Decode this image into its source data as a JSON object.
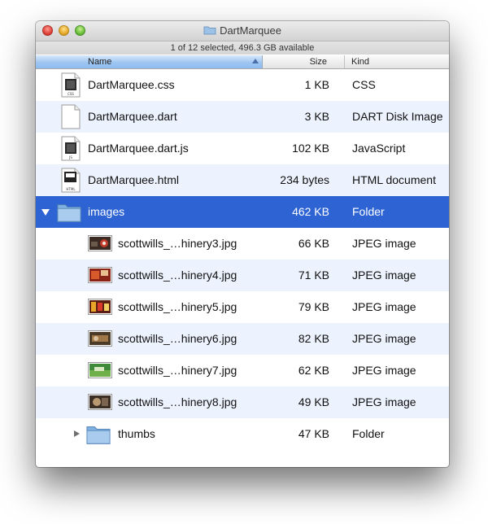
{
  "window": {
    "title": "DartMarquee",
    "status": "1 of 12 selected, 496.3 GB available"
  },
  "columns": {
    "name": "Name",
    "size": "Size",
    "kind": "Kind"
  },
  "rows": [
    {
      "name": "DartMarquee.css",
      "size": "1 KB",
      "kind": "CSS",
      "icon": "css-file-icon",
      "badge": "CSS"
    },
    {
      "name": "DartMarquee.dart",
      "size": "3 KB",
      "kind": "DART Disk Image",
      "icon": "blank-file-icon",
      "badge": ""
    },
    {
      "name": "DartMarquee.dart.js",
      "size": "102 KB",
      "kind": "JavaScript",
      "icon": "js-file-icon",
      "badge": "JS"
    },
    {
      "name": "DartMarquee.html",
      "size": "234 bytes",
      "kind": "HTML document",
      "icon": "html-file-icon",
      "badge": "HTML"
    },
    {
      "name": "images",
      "size": "462 KB",
      "kind": "Folder",
      "icon": "folder-icon"
    },
    {
      "name": "scottwills_…hinery3.jpg",
      "size": "66 KB",
      "kind": "JPEG image",
      "icon": "jpeg-thumbnail-icon"
    },
    {
      "name": "scottwills_…hinery4.jpg",
      "size": "71 KB",
      "kind": "JPEG image",
      "icon": "jpeg-thumbnail-icon"
    },
    {
      "name": "scottwills_…hinery5.jpg",
      "size": "79 KB",
      "kind": "JPEG image",
      "icon": "jpeg-thumbnail-icon"
    },
    {
      "name": "scottwills_…hinery6.jpg",
      "size": "82 KB",
      "kind": "JPEG image",
      "icon": "jpeg-thumbnail-icon"
    },
    {
      "name": "scottwills_…hinery7.jpg",
      "size": "62 KB",
      "kind": "JPEG image",
      "icon": "jpeg-thumbnail-icon"
    },
    {
      "name": "scottwills_…hinery8.jpg",
      "size": "49 KB",
      "kind": "JPEG image",
      "icon": "jpeg-thumbnail-icon"
    },
    {
      "name": "thumbs",
      "size": "47 KB",
      "kind": "Folder",
      "icon": "folder-icon"
    }
  ],
  "colors": {
    "selection": "#2e63d3",
    "alternate_row": "#edf3fe",
    "header_sorted": "#9fc6f1"
  }
}
